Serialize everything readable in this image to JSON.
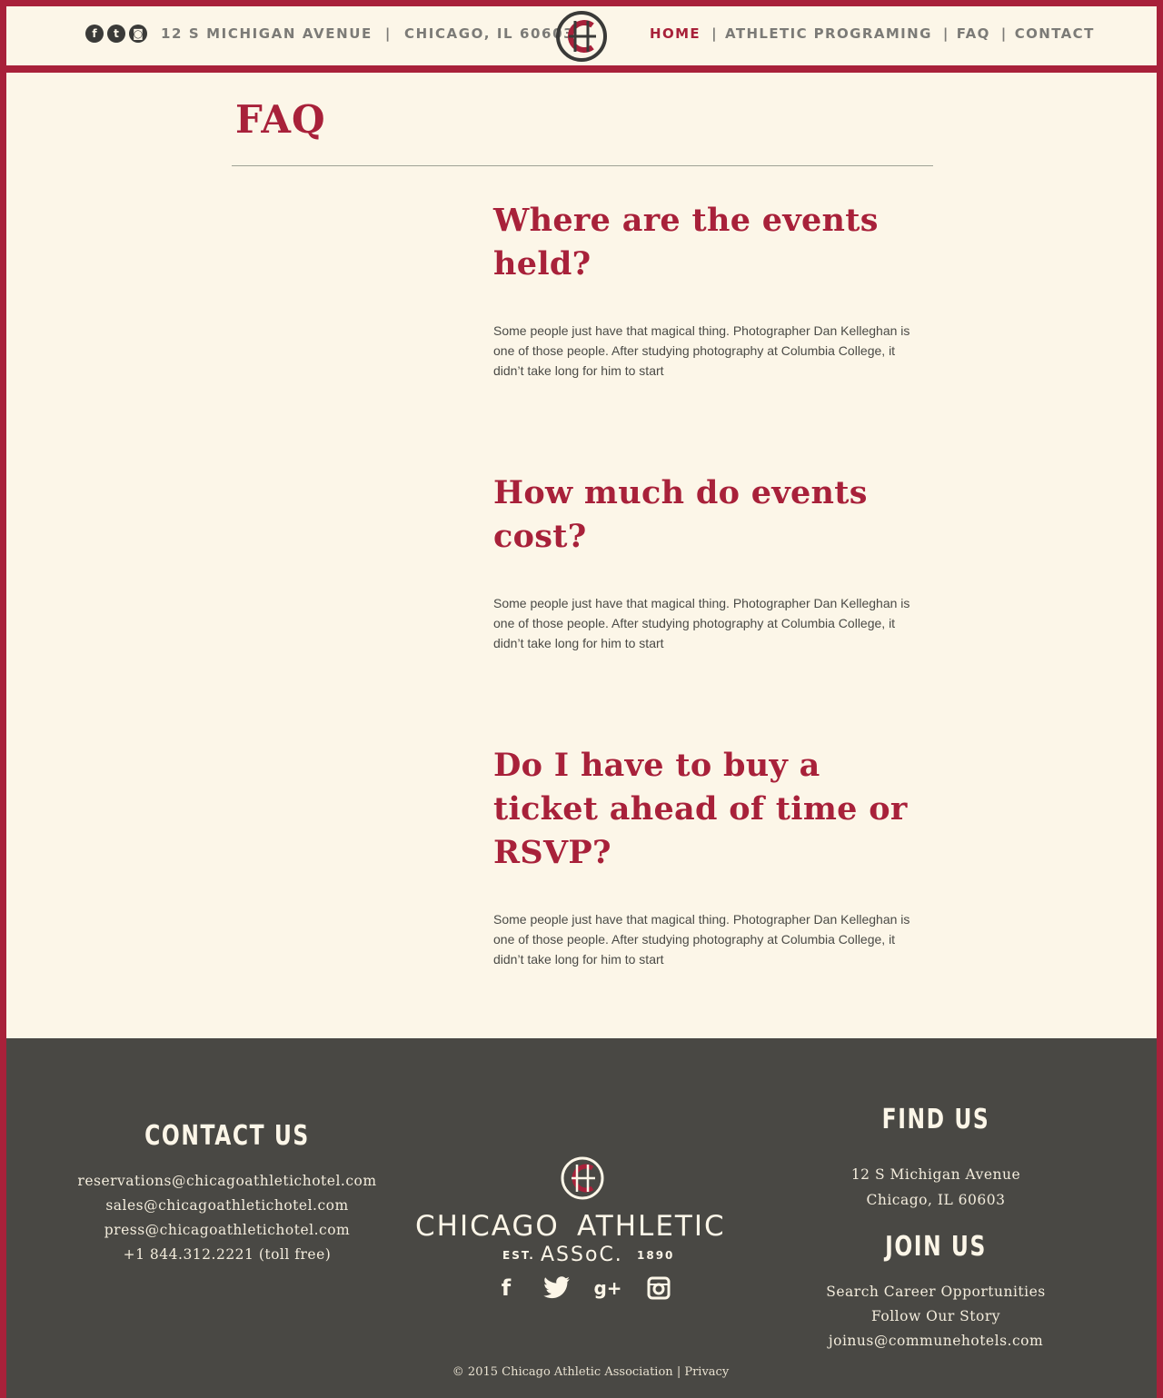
{
  "header": {
    "social": [
      {
        "icon": "facebook-icon",
        "glyph": "f"
      },
      {
        "icon": "twitter-icon",
        "glyph": "t"
      },
      {
        "icon": "instagram-icon",
        "glyph": "◙"
      }
    ],
    "address_street": "12 S MICHIGAN AVENUE",
    "address_separator": "|",
    "address_city": "CHICAGO, IL 60603",
    "nav": {
      "home": "HOME",
      "athletic": "ATHLETIC PROGRAMING",
      "faq": "FAQ",
      "contact": "CONTACT",
      "separator": "|"
    }
  },
  "main": {
    "title": "FAQ",
    "faqs": [
      {
        "question": "Where are the events held?",
        "answer": "Some people just have that magical thing. Photographer Dan Kelleghan is one of those people. After studying photography at Columbia College, it didn’t take long for him to start"
      },
      {
        "question": "How much do events cost?",
        "answer": "Some people just have that magical thing. Photographer Dan Kelleghan is one of those people. After studying photography at Columbia College, it didn’t take long for him to start"
      },
      {
        "question": "Do I have to buy a ticket ahead of time or RSVP?",
        "answer": "Some people just have that magical thing. Photographer Dan Kelleghan is one of those people. After studying photography at Columbia College, it didn’t take long for him to start"
      }
    ]
  },
  "footer": {
    "contact": {
      "heading": "CONTACT US",
      "lines": [
        "reservations@chicagoathletichotel.com",
        "sales@chicagoathletichotel.com",
        "press@chicagoathletichotel.com",
        "+1 844.312.2221 (toll free)"
      ]
    },
    "logo": {
      "name_left": "CHICAGO",
      "name_right": "ATHLETIC",
      "est": "EST.",
      "assoc": "ASSoC.",
      "year": "1890"
    },
    "social": [
      {
        "icon": "facebook-icon",
        "glyph": "f"
      },
      {
        "icon": "twitter-icon",
        "glyph": "🐦"
      },
      {
        "icon": "google-plus-icon",
        "glyph": "g+"
      },
      {
        "icon": "instagram-icon",
        "glyph": "◙"
      }
    ],
    "find": {
      "heading": "FIND US",
      "lines": [
        "12 S Michigan Avenue",
        "Chicago, IL 60603"
      ]
    },
    "join": {
      "heading": "JOIN US",
      "lines": [
        "Search Career Opportunities",
        "Follow Our Story",
        "joinus@communehotels.com"
      ]
    },
    "copyright": "© 2015 Chicago Athletic Association",
    "copyright_sep": "|",
    "privacy": "Privacy"
  },
  "colors": {
    "brand_red": "#a8213a",
    "cream": "#fcf6e8",
    "footer_gray": "#494844",
    "text_gray": "#7c7b77"
  }
}
